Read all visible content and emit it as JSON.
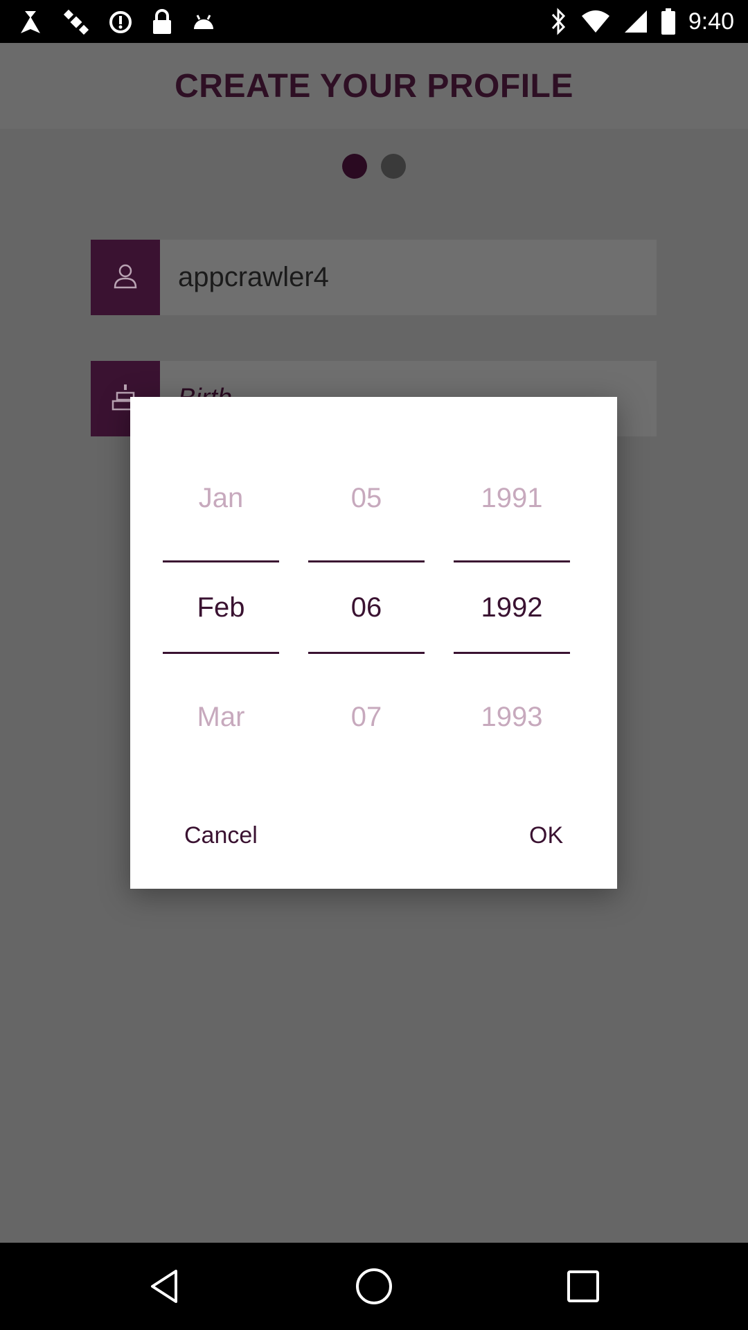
{
  "status_bar": {
    "time": "9:40",
    "icons_left": [
      "fake-gps-icon",
      "satellite-icon",
      "sync-icon",
      "lock-icon",
      "android-icon"
    ],
    "icons_right": [
      "bluetooth-icon",
      "wifi-icon",
      "signal-icon",
      "battery-icon"
    ]
  },
  "header": {
    "title": "CREATE YOUR PROFILE"
  },
  "page_indicator": {
    "total": 2,
    "active_index": 0
  },
  "form": {
    "username": {
      "value": "appcrawler4",
      "icon": "person-icon"
    },
    "birth": {
      "placeholder": "Birth",
      "icon": "birthday-cake-icon"
    }
  },
  "date_picker": {
    "month": {
      "prev": "Jan",
      "selected": "Feb",
      "next": "Mar"
    },
    "day": {
      "prev": "05",
      "selected": "06",
      "next": "07"
    },
    "year": {
      "prev": "1991",
      "selected": "1992",
      "next": "1993"
    },
    "cancel_label": "Cancel",
    "ok_label": "OK"
  },
  "colors": {
    "accent": "#3a1231",
    "faded_text": "#c7a9bd",
    "overlay_background": "#666666"
  },
  "nav_bar": {
    "buttons": [
      "back-icon",
      "home-icon",
      "recents-icon"
    ]
  }
}
